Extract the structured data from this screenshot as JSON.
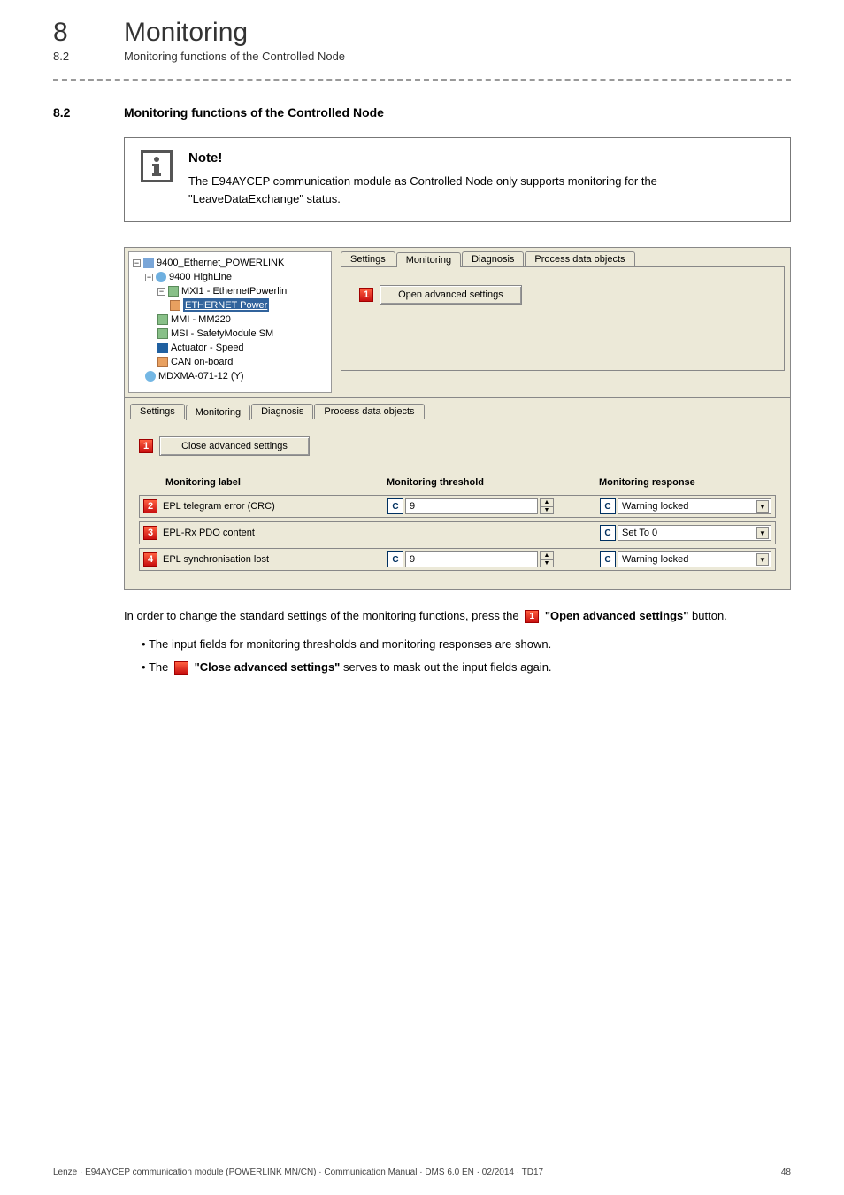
{
  "header": {
    "chapter_num": "8",
    "chapter_title": "Monitoring",
    "sub_num": "8.2",
    "sub_title": "Monitoring functions of the Controlled Node"
  },
  "section": {
    "num": "8.2",
    "title": "Monitoring functions of the Controlled Node"
  },
  "note": {
    "heading": "Note!",
    "text": "The E94AYCEP communication module as Controlled Node only supports monitoring for the \"LeaveDataExchange\" status."
  },
  "shot1": {
    "tree": {
      "root": "9400_Ethernet_POWERLINK",
      "n1": "9400 HighLine",
      "n2": "MXI1 - EthernetPowerlin",
      "n3_sel": "ETHERNET Power",
      "n4": "MMI - MM220",
      "n5": "MSI - SafetyModule SM",
      "n6": "Actuator - Speed",
      "n7": "CAN on-board",
      "n8": "MDXMA-071-12 (Y)"
    },
    "tabs": {
      "t1": "Settings",
      "t2": "Monitoring",
      "t3": "Diagnosis",
      "t4": "Process data objects"
    },
    "open_btn": "Open advanced settings",
    "marker": "1"
  },
  "shot2": {
    "tabs": {
      "t1": "Settings",
      "t2": "Monitoring",
      "t3": "Diagnosis",
      "t4": "Process data objects"
    },
    "close_btn": "Close advanced settings",
    "close_marker": "1",
    "headers": {
      "c1": "Monitoring label",
      "c2": "Monitoring threshold",
      "c3": "Monitoring response"
    },
    "rows": [
      {
        "m": "2",
        "label": "EPL telegram error (CRC)",
        "thresh": "9",
        "c": "C",
        "resp": "Warning locked"
      },
      {
        "m": "3",
        "label": "EPL-Rx PDO content",
        "thresh": "",
        "c": "C",
        "resp": "Set To 0"
      },
      {
        "m": "4",
        "label": "EPL synchronisation lost",
        "thresh": "9",
        "c": "C",
        "resp": "Warning locked"
      }
    ]
  },
  "body": {
    "p1a": "In order to change the standard settings of the monitoring functions, press the ",
    "p1m": "1",
    "p1b": " \"Open advanced settings\"",
    "p1c": " button.",
    "b1": "The input fields for monitoring thresholds and monitoring responses are shown.",
    "b2a": "The ",
    "b2m": "1",
    "b2b": " \"Close advanced settings\"",
    "b2c": " serves to mask out the input fields again."
  },
  "footer": {
    "left": "Lenze · E94AYCEP communication module (POWERLINK MN/CN) · Communication Manual · DMS 6.0 EN · 02/2014 · TD17",
    "right": "48"
  }
}
